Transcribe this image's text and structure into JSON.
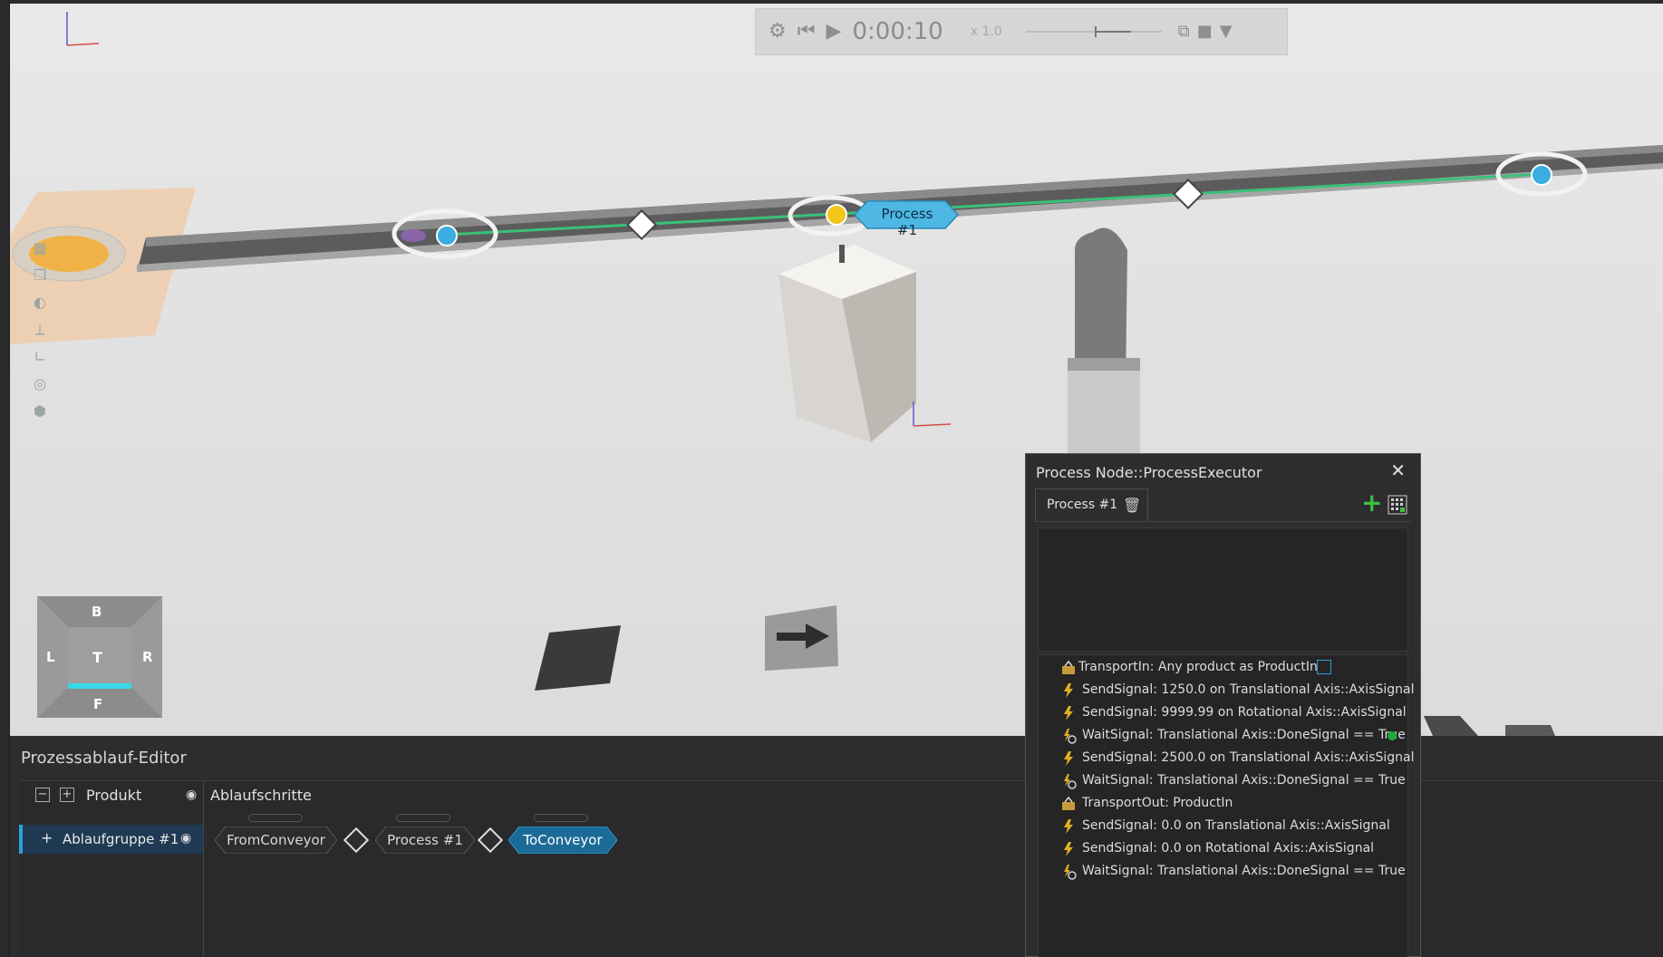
{
  "playback": {
    "time": "0:00:10",
    "speed": "x 1.0"
  },
  "viewport": {
    "process_tag": "Process #1"
  },
  "viewcube": {
    "top": "B",
    "left": "L",
    "center": "T",
    "right": "R",
    "bottom": "F"
  },
  "editor": {
    "title": "Prozessablauf-Editor",
    "col_product": "Produkt",
    "col_steps": "Ablaufschritte",
    "group_name": "Ablaufgruppe #1",
    "steps": [
      "FromConveyor",
      "Process #1",
      "ToConveyor"
    ]
  },
  "dialog": {
    "title": "Process Node::ProcessExecutor",
    "tab_label": "Process #1",
    "items": [
      {
        "text": "TransportIn: Any product as ProductIn",
        "icon": "transport-icon"
      },
      {
        "text": "SendSignal: 1250.0 on Translational Axis::AxisSignal",
        "icon": "send-signal-icon"
      },
      {
        "text": "SendSignal: 9999.99 on Rotational Axis::AxisSignal",
        "icon": "send-signal-icon"
      },
      {
        "text": "WaitSignal: Translational Axis::DoneSignal == True",
        "icon": "wait-signal-icon"
      },
      {
        "text": "SendSignal: 2500.0 on Translational Axis::AxisSignal",
        "icon": "send-signal-icon"
      },
      {
        "text": "WaitSignal: Translational Axis::DoneSignal == True",
        "icon": "wait-signal-icon"
      },
      {
        "text": "TransportOut: ProductIn",
        "icon": "transport-icon"
      },
      {
        "text": "SendSignal: 0.0 on Translational Axis::AxisSignal",
        "icon": "send-signal-icon"
      },
      {
        "text": "SendSignal: 0.0 on Rotational Axis::AxisSignal",
        "icon": "send-signal-icon"
      },
      {
        "text": "WaitSignal: Translational Axis::DoneSignal == True",
        "icon": "wait-signal-icon"
      }
    ]
  },
  "colors": {
    "accent": "#29a3d8",
    "add_green": "#3fbf3f",
    "path_green": "#3cc07a",
    "node_yellow": "#f3c61a"
  }
}
